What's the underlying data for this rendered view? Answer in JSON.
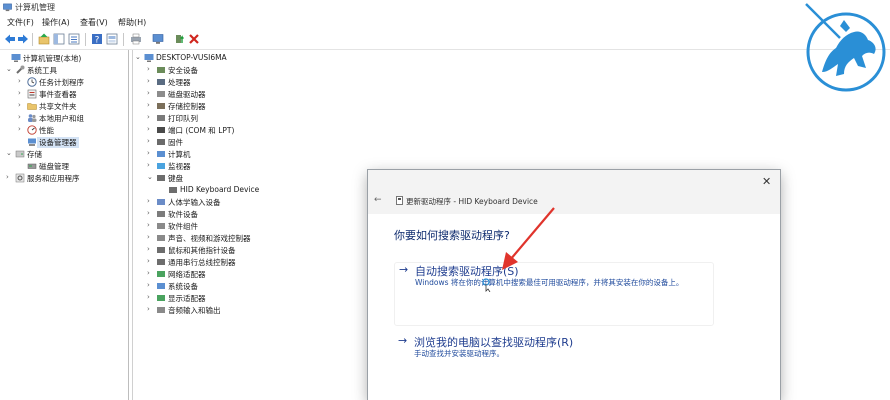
{
  "window": {
    "title": "计算机管理"
  },
  "menubar": {
    "items": [
      "文件(F)",
      "操作(A)",
      "查看(V)",
      "帮助(H)"
    ]
  },
  "toolbar": {
    "buttons": [
      "back-icon",
      "forward-icon",
      "up-icon",
      "show-hide-tree-icon",
      "properties-icon",
      "help-icon",
      "view-icon",
      "print-icon",
      "monitor-icon",
      "update-driver-icon",
      "uninstall-icon"
    ]
  },
  "left_tree": {
    "items": [
      {
        "label": "计算机管理(本地)",
        "icon": "computer-mgmt-icon",
        "expander": ""
      },
      {
        "label": "系统工具",
        "icon": "tools-icon",
        "expander": "⌄"
      },
      {
        "label": "任务计划程序",
        "icon": "clock-icon",
        "expander": "›"
      },
      {
        "label": "事件查看器",
        "icon": "event-icon",
        "expander": "›"
      },
      {
        "label": "共享文件夹",
        "icon": "folder-icon",
        "expander": "›"
      },
      {
        "label": "本地用户和组",
        "icon": "users-icon",
        "expander": "›"
      },
      {
        "label": "性能",
        "icon": "perf-icon",
        "expander": "›"
      },
      {
        "label": "设备管理器",
        "icon": "device-mgr-icon",
        "expander": "",
        "selected": true
      },
      {
        "label": "存储",
        "icon": "storage-icon",
        "expander": "⌄"
      },
      {
        "label": "磁盘管理",
        "icon": "disk-icon",
        "expander": ""
      },
      {
        "label": "服务和应用程序",
        "icon": "services-icon",
        "expander": "›"
      }
    ]
  },
  "device_tree": {
    "root": "DESKTOP-VUSI6MA",
    "items": [
      {
        "label": "安全设备",
        "icon": "security-icon",
        "expander": "›"
      },
      {
        "label": "处理器",
        "icon": "cpu-icon",
        "expander": "›"
      },
      {
        "label": "磁盘驱动器",
        "icon": "disk-drive-icon",
        "expander": "›"
      },
      {
        "label": "存储控制器",
        "icon": "storage-ctrl-icon",
        "expander": "›"
      },
      {
        "label": "打印队列",
        "icon": "printer-icon",
        "expander": "›"
      },
      {
        "label": "端口 (COM 和 LPT)",
        "icon": "port-icon",
        "expander": "›"
      },
      {
        "label": "固件",
        "icon": "firmware-icon",
        "expander": "›"
      },
      {
        "label": "计算机",
        "icon": "pc-icon",
        "expander": "›"
      },
      {
        "label": "监视器",
        "icon": "monitor-icon",
        "expander": "›"
      },
      {
        "label": "键盘",
        "icon": "keyboard-icon",
        "expander": "⌄"
      },
      {
        "label": "HID Keyboard Device",
        "icon": "keyboard-icon",
        "expander": "",
        "child": true
      },
      {
        "label": "人体学输入设备",
        "icon": "hid-icon",
        "expander": "›"
      },
      {
        "label": "软件设备",
        "icon": "software-device-icon",
        "expander": "›"
      },
      {
        "label": "软件组件",
        "icon": "software-component-icon",
        "expander": "›"
      },
      {
        "label": "声音、视频和游戏控制器",
        "icon": "sound-icon",
        "expander": "›"
      },
      {
        "label": "鼠标和其他指针设备",
        "icon": "mouse-icon",
        "expander": "›"
      },
      {
        "label": "通用串行总线控制器",
        "icon": "usb-icon",
        "expander": "›"
      },
      {
        "label": "网络适配器",
        "icon": "network-icon",
        "expander": "›"
      },
      {
        "label": "系统设备",
        "icon": "system-device-icon",
        "expander": "›"
      },
      {
        "label": "显示适配器",
        "icon": "display-adapter-icon",
        "expander": "›"
      },
      {
        "label": "音频输入和输出",
        "icon": "audio-io-icon",
        "expander": "›"
      }
    ]
  },
  "dialog": {
    "close": "✕",
    "back": "←",
    "title": "更新驱动程序 - HID Keyboard Device",
    "question": "你要如何搜索驱动程序?",
    "option1": {
      "arrow": "→",
      "title": "自动搜索驱动程序(S)",
      "desc": "Windows 将在你的计算机中搜索最佳可用驱动程序，并将其安装在你的设备上。"
    },
    "option2": {
      "arrow": "→",
      "title": "浏览我的电脑以查找驱动程序(R)",
      "desc": "手动查找并安装驱动程序。"
    }
  },
  "colors": {
    "accent": "#1f3d8f",
    "logo": "#2a8fd6",
    "arrow_annotation": "#e0342c"
  }
}
